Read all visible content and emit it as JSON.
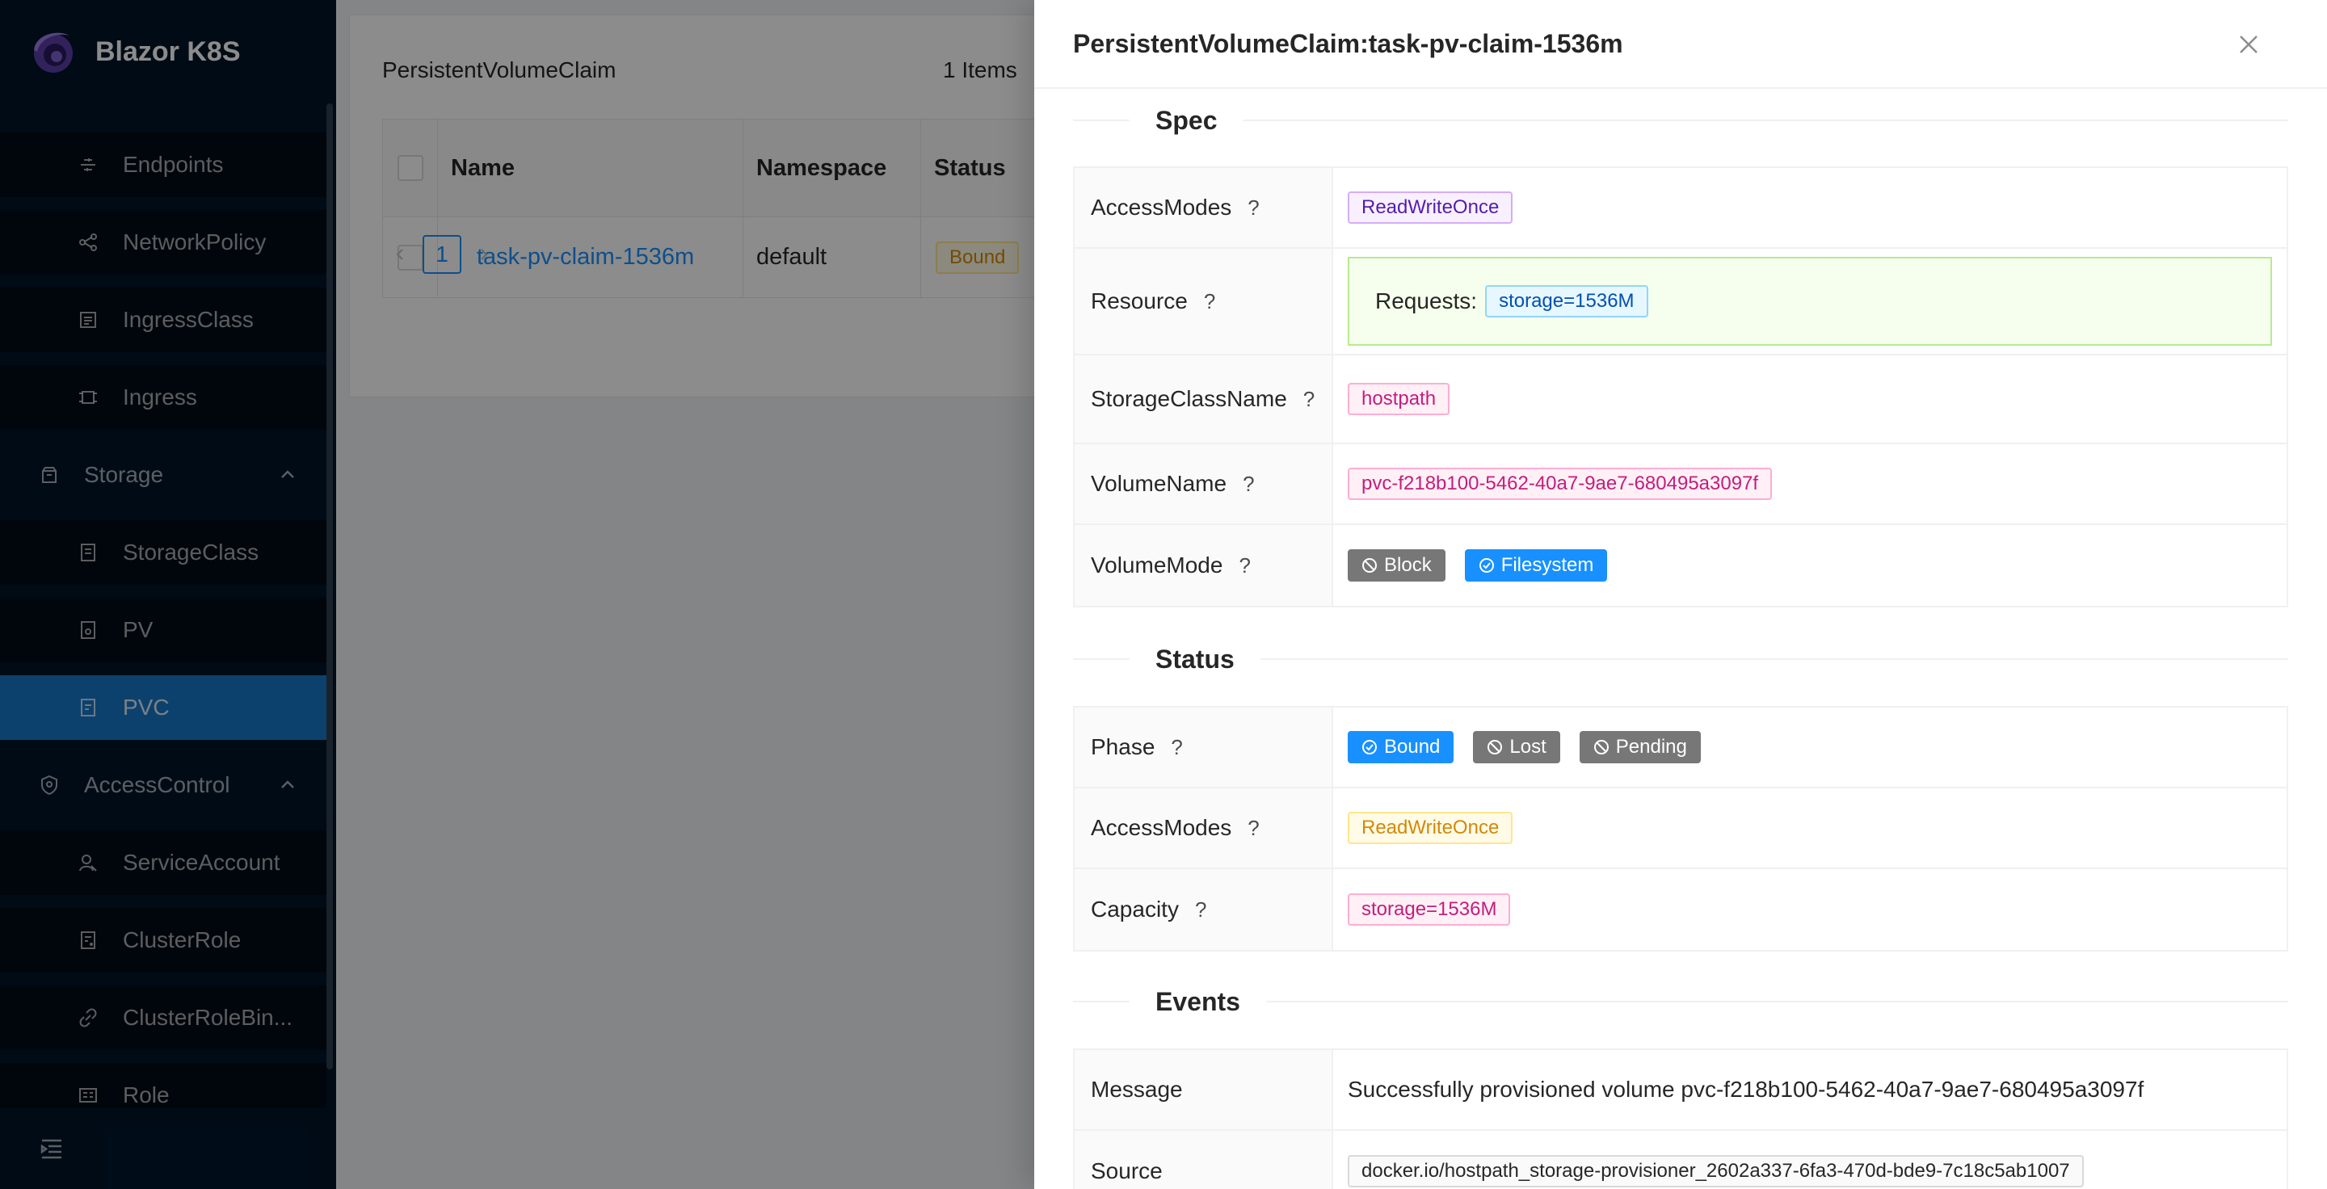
{
  "app": {
    "title": "Blazor K8S"
  },
  "sidebar": {
    "items": [
      {
        "label": "Endpoints",
        "icon": "endpoints-icon"
      },
      {
        "label": "NetworkPolicy",
        "icon": "network-policy-icon"
      },
      {
        "label": "IngressClass",
        "icon": "ingress-class-icon"
      },
      {
        "label": "Ingress",
        "icon": "ingress-icon"
      },
      {
        "label": "Storage",
        "icon": "storage-icon"
      },
      {
        "label": "StorageClass",
        "icon": "storage-class-icon"
      },
      {
        "label": "PV",
        "icon": "pv-icon"
      },
      {
        "label": "PVC",
        "icon": "pvc-icon"
      },
      {
        "label": "AccessControl",
        "icon": "access-control-icon"
      },
      {
        "label": "ServiceAccount",
        "icon": "service-account-icon"
      },
      {
        "label": "ClusterRole",
        "icon": "cluster-role-icon"
      },
      {
        "label": "ClusterRoleBin...",
        "icon": "cluster-role-binding-icon"
      },
      {
        "label": "Role",
        "icon": "role-icon"
      }
    ],
    "selected": "PVC"
  },
  "list": {
    "title": "PersistentVolumeClaim",
    "count": "1 Items",
    "columns": [
      "Name",
      "Namespace",
      "Status"
    ],
    "rows": [
      {
        "name": "task-pv-claim-1536m",
        "namespace": "default",
        "status": "Bound"
      }
    ],
    "page": "1"
  },
  "drawer": {
    "title": "PersistentVolumeClaim:task-pv-claim-1536m",
    "spec": {
      "heading": "Spec",
      "access_modes_label": "AccessModes",
      "access_modes": "ReadWriteOnce",
      "resource_label": "Resource",
      "requests_label": "Requests:",
      "requests": "storage=1536M",
      "storage_class_label": "StorageClassName",
      "storage_class": "hostpath",
      "volume_name_label": "VolumeName",
      "volume_name": "pvc-f218b100-5462-40a7-9ae7-680495a3097f",
      "volume_mode_label": "VolumeMode",
      "volume_modes": [
        {
          "label": "Block",
          "active": false
        },
        {
          "label": "Filesystem",
          "active": true
        }
      ]
    },
    "status": {
      "heading": "Status",
      "phase_label": "Phase",
      "phases": [
        {
          "label": "Bound",
          "active": true
        },
        {
          "label": "Lost",
          "active": false
        },
        {
          "label": "Pending",
          "active": false
        }
      ],
      "access_modes_label": "AccessModes",
      "access_modes": "ReadWriteOnce",
      "capacity_label": "Capacity",
      "capacity": "storage=1536M"
    },
    "events": {
      "heading": "Events",
      "message_label": "Message",
      "message": "Successfully provisioned volume pvc-f218b100-5462-40a7-9ae7-680495a3097f",
      "source_label": "Source",
      "source": "docker.io/hostpath_storage-provisioner_2602a337-6fa3-470d-bde9-7c18c5ab1007"
    },
    "help": "?"
  },
  "colors": {
    "sidebar_bg": "#001529",
    "accent": "#1890ff",
    "selected_menu": "#1677c6"
  }
}
